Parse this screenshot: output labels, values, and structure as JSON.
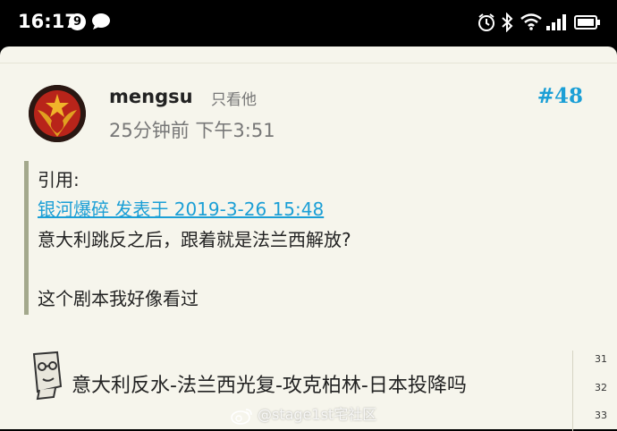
{
  "status_bar": {
    "time": "16:17",
    "notification_count": "9",
    "icons": [
      "chat-bubble-icon",
      "alarm-icon",
      "bluetooth-icon",
      "wifi-icon",
      "signal-icon",
      "battery-icon"
    ]
  },
  "post": {
    "username": "mengsu",
    "only_view_him": "只看他",
    "post_number": "#48",
    "time": "25分钟前 下午3:51",
    "quote": {
      "title": "引用:",
      "author_line": "银河爆碎 发表于 2019-3-26 15:48",
      "text_line1": "意大利跳反之后，跟着就是法兰西解放?",
      "text_line2": "这个剧本我好像看过"
    },
    "body_text": "意大利反水-法兰西光复-攻克柏林-日本投降吗"
  },
  "line_numbers": [
    "31",
    "32",
    "33"
  ],
  "watermark": "@stage1st宅社区",
  "colors": {
    "accent": "#1b9fd6",
    "background": "#f6f5ec",
    "quote_bar": "#a3a88c"
  }
}
